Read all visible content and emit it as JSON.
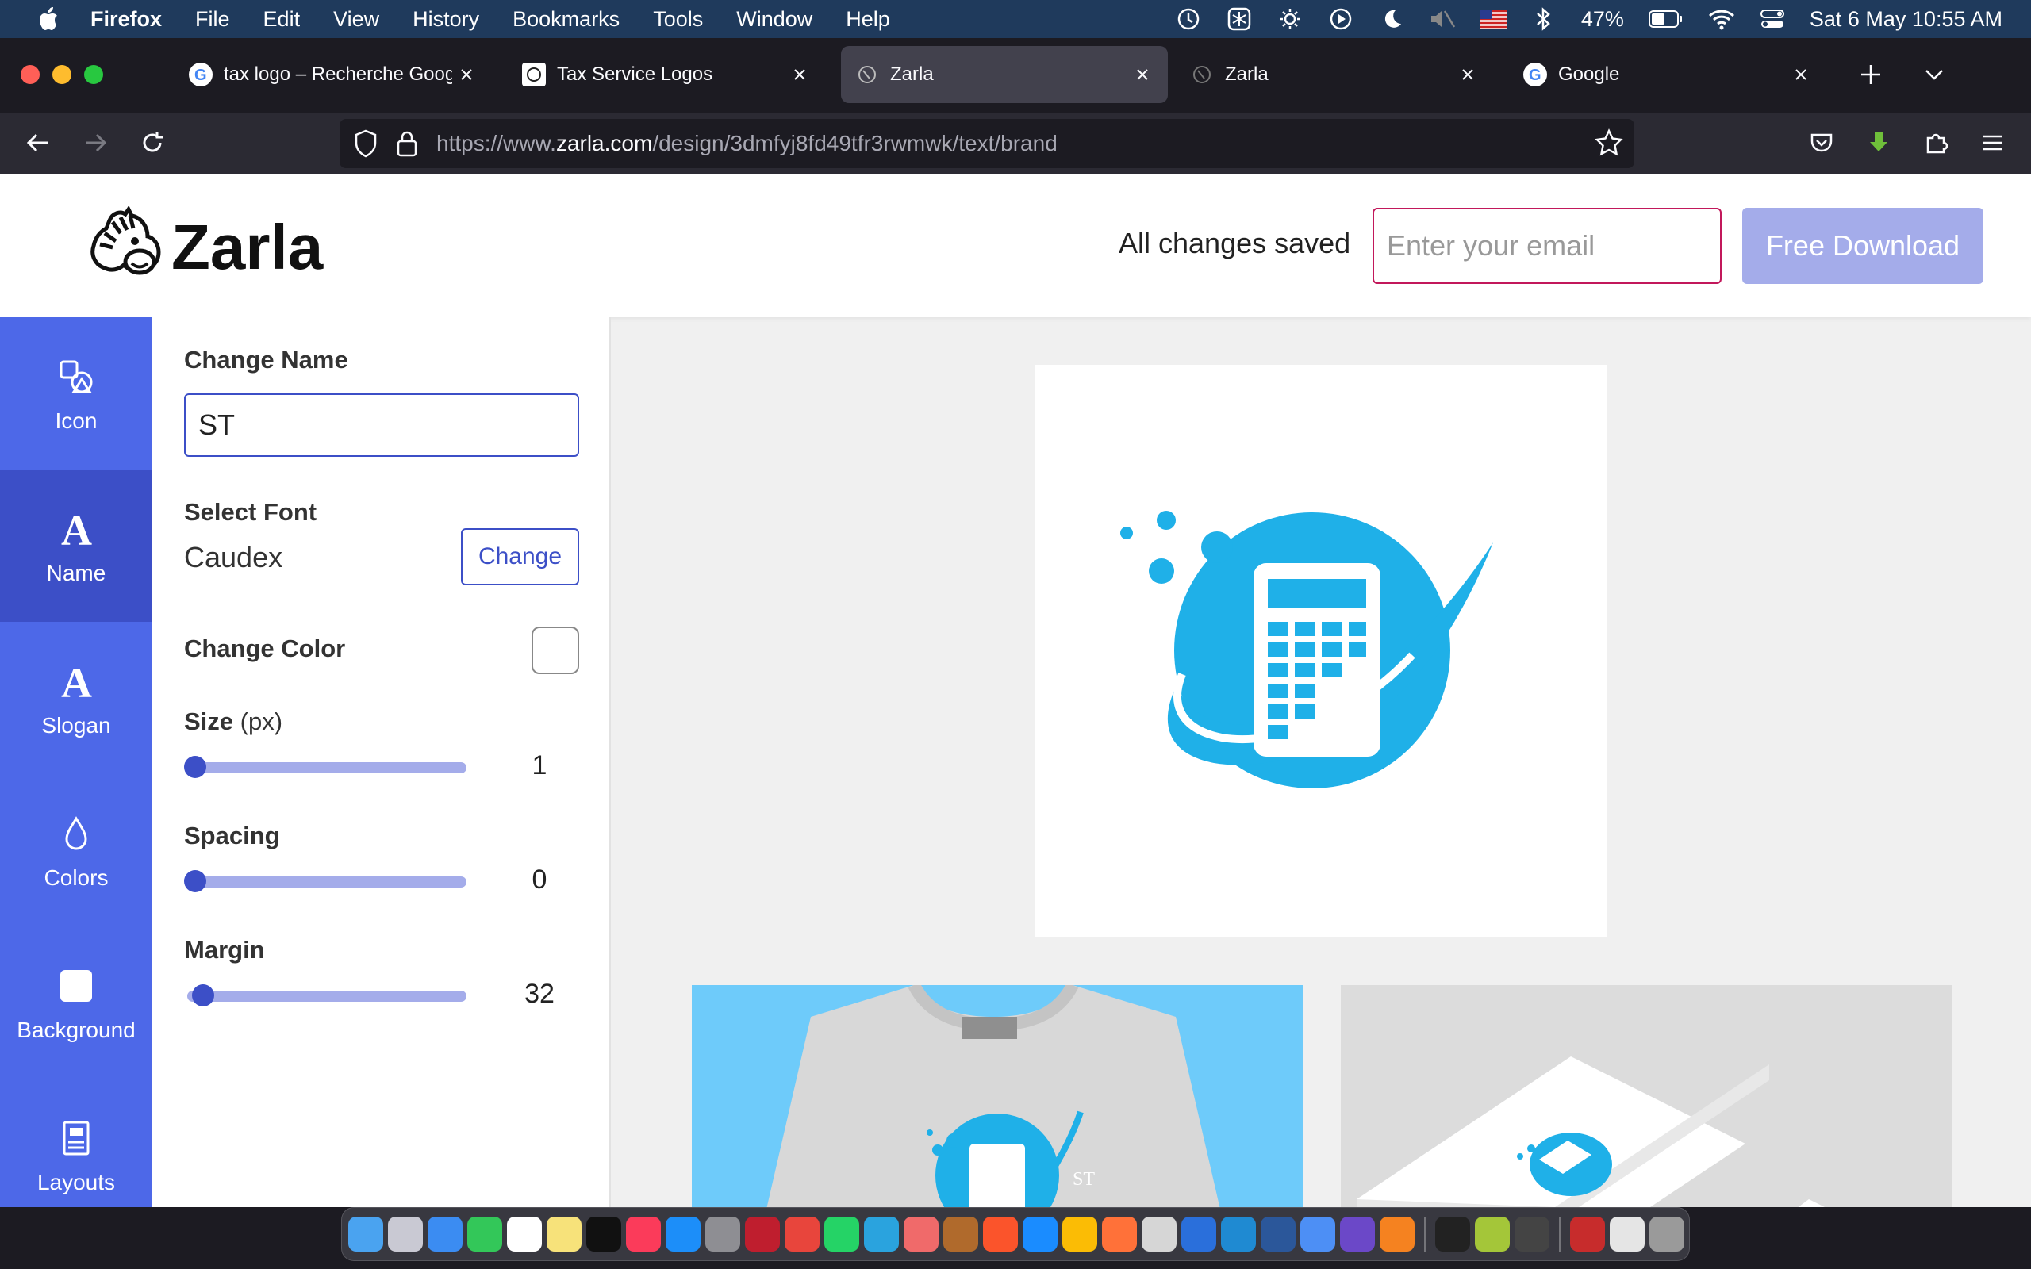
{
  "menubar": {
    "app": "Firefox",
    "items": [
      "File",
      "Edit",
      "View",
      "History",
      "Bookmarks",
      "Tools",
      "Window",
      "Help"
    ],
    "battery": "47%",
    "datetime": "Sat 6 May  10:55 AM"
  },
  "browser": {
    "tabs": [
      {
        "label": "tax logo – Recherche Google",
        "active": false
      },
      {
        "label": "Tax Service Logos",
        "active": false
      },
      {
        "label": "Zarla",
        "active": true
      },
      {
        "label": "Zarla",
        "active": false
      },
      {
        "label": "Google",
        "active": false
      }
    ],
    "url_prefix": "https://www.",
    "url_domain": "zarla.com",
    "url_path": "/design/3dmfyj8fd49tfr3rwmwk/text/brand"
  },
  "header": {
    "logo": "Zarla",
    "status": "All changes saved",
    "email_placeholder": "Enter your email",
    "download_label": "Free Download"
  },
  "sidebar": {
    "items": [
      {
        "label": "Icon"
      },
      {
        "label": "Name",
        "active": true
      },
      {
        "label": "Slogan"
      },
      {
        "label": "Colors"
      },
      {
        "label": "Background"
      },
      {
        "label": "Layouts"
      }
    ]
  },
  "panel": {
    "change_name_label": "Change Name",
    "name_value": "ST",
    "select_font_label": "Select Font",
    "font_value": "Caudex",
    "change_font_button": "Change",
    "change_color_label": "Change Color",
    "size_label": "Size",
    "size_unit": "(px)",
    "size_value": "1",
    "spacing_label": "Spacing",
    "spacing_value": "0",
    "margin_label": "Margin",
    "margin_value": "32"
  },
  "mockup": {
    "tshirt_text": "ST"
  },
  "colors": {
    "brand_blue": "#4d68e8",
    "logo_blue": "#1fb0e8"
  }
}
